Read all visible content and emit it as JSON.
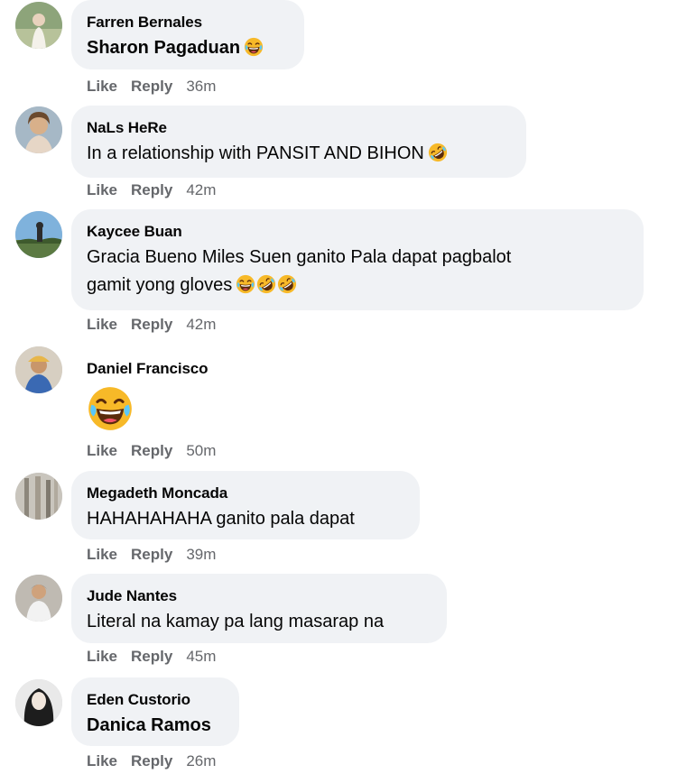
{
  "comments": [
    {
      "author": "Farren Bernales",
      "text": "Sharon Pagaduan",
      "emojis": [
        "laughing-tears-icon"
      ],
      "like_label": "Like",
      "reply_label": "Reply",
      "time": "36m"
    },
    {
      "author": "NaLs HeRe",
      "text": "In a relationship with PANSIT AND BIHON",
      "emojis": [
        "rofl-icon"
      ],
      "like_label": "Like",
      "reply_label": "Reply",
      "time": "42m"
    },
    {
      "author": "Kaycee Buan",
      "text_line1": "Gracia Bueno Miles Suen ganito Pala dapat pagbalot",
      "text_line2": "gamit yong gloves",
      "emojis": [
        "laughing-tears-icon",
        "rofl-icon",
        "rofl-icon"
      ],
      "like_label": "Like",
      "reply_label": "Reply",
      "time": "42m"
    },
    {
      "author": "Daniel Francisco",
      "emojis": [
        "laughing-tears-icon"
      ],
      "like_label": "Like",
      "reply_label": "Reply",
      "time": "50m"
    },
    {
      "author": "Megadeth Moncada",
      "text": "HAHAHAHAHA ganito pala dapat",
      "like_label": "Like",
      "reply_label": "Reply",
      "time": "39m"
    },
    {
      "author": "Jude Nantes",
      "text": "Literal na kamay pa lang masarap na",
      "like_label": "Like",
      "reply_label": "Reply",
      "time": "45m"
    },
    {
      "author": "Eden Custorio",
      "text": "Danica Ramos",
      "like_label": "Like",
      "reply_label": "Reply",
      "time": "26m"
    }
  ],
  "colors": {
    "bubble": "#f0f2f5",
    "meta_text": "#65676b",
    "emoji_face": "#f7b928",
    "emoji_mouth": "#5a2b0b"
  }
}
